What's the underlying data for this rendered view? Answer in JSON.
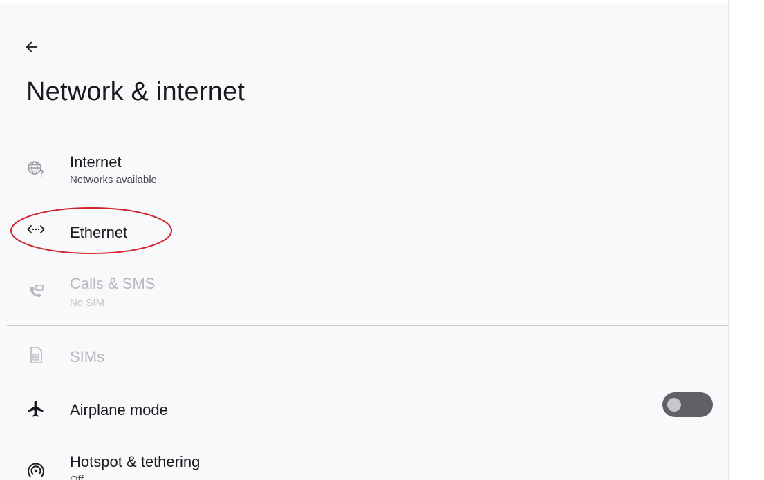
{
  "header": {
    "back_icon": "arrow-left-icon",
    "title": "Network & internet"
  },
  "items": [
    {
      "label": "Internet",
      "subtitle": "Networks available",
      "icon": "globe-question-icon",
      "disabled": false
    },
    {
      "label": "Ethernet",
      "subtitle": "",
      "icon": "ethernet-icon",
      "disabled": false,
      "highlighted": true
    },
    {
      "label": "Calls & SMS",
      "subtitle": "No SIM",
      "icon": "phone-sms-icon",
      "disabled": true
    },
    {
      "label": "SIMs",
      "subtitle": "",
      "icon": "sim-card-icon",
      "disabled": true
    },
    {
      "label": "Airplane mode",
      "subtitle": "",
      "icon": "airplane-icon",
      "disabled": false,
      "toggle": false
    },
    {
      "label": "Hotspot & tethering",
      "subtitle": "Off",
      "icon": "hotspot-icon",
      "disabled": false
    }
  ],
  "colors": {
    "background": "#f8f9fa",
    "text": "#1b1b1f",
    "disabled_text": "#b7b8bd",
    "annotation": "#d0252f",
    "toggle_off": "#5f6167"
  }
}
